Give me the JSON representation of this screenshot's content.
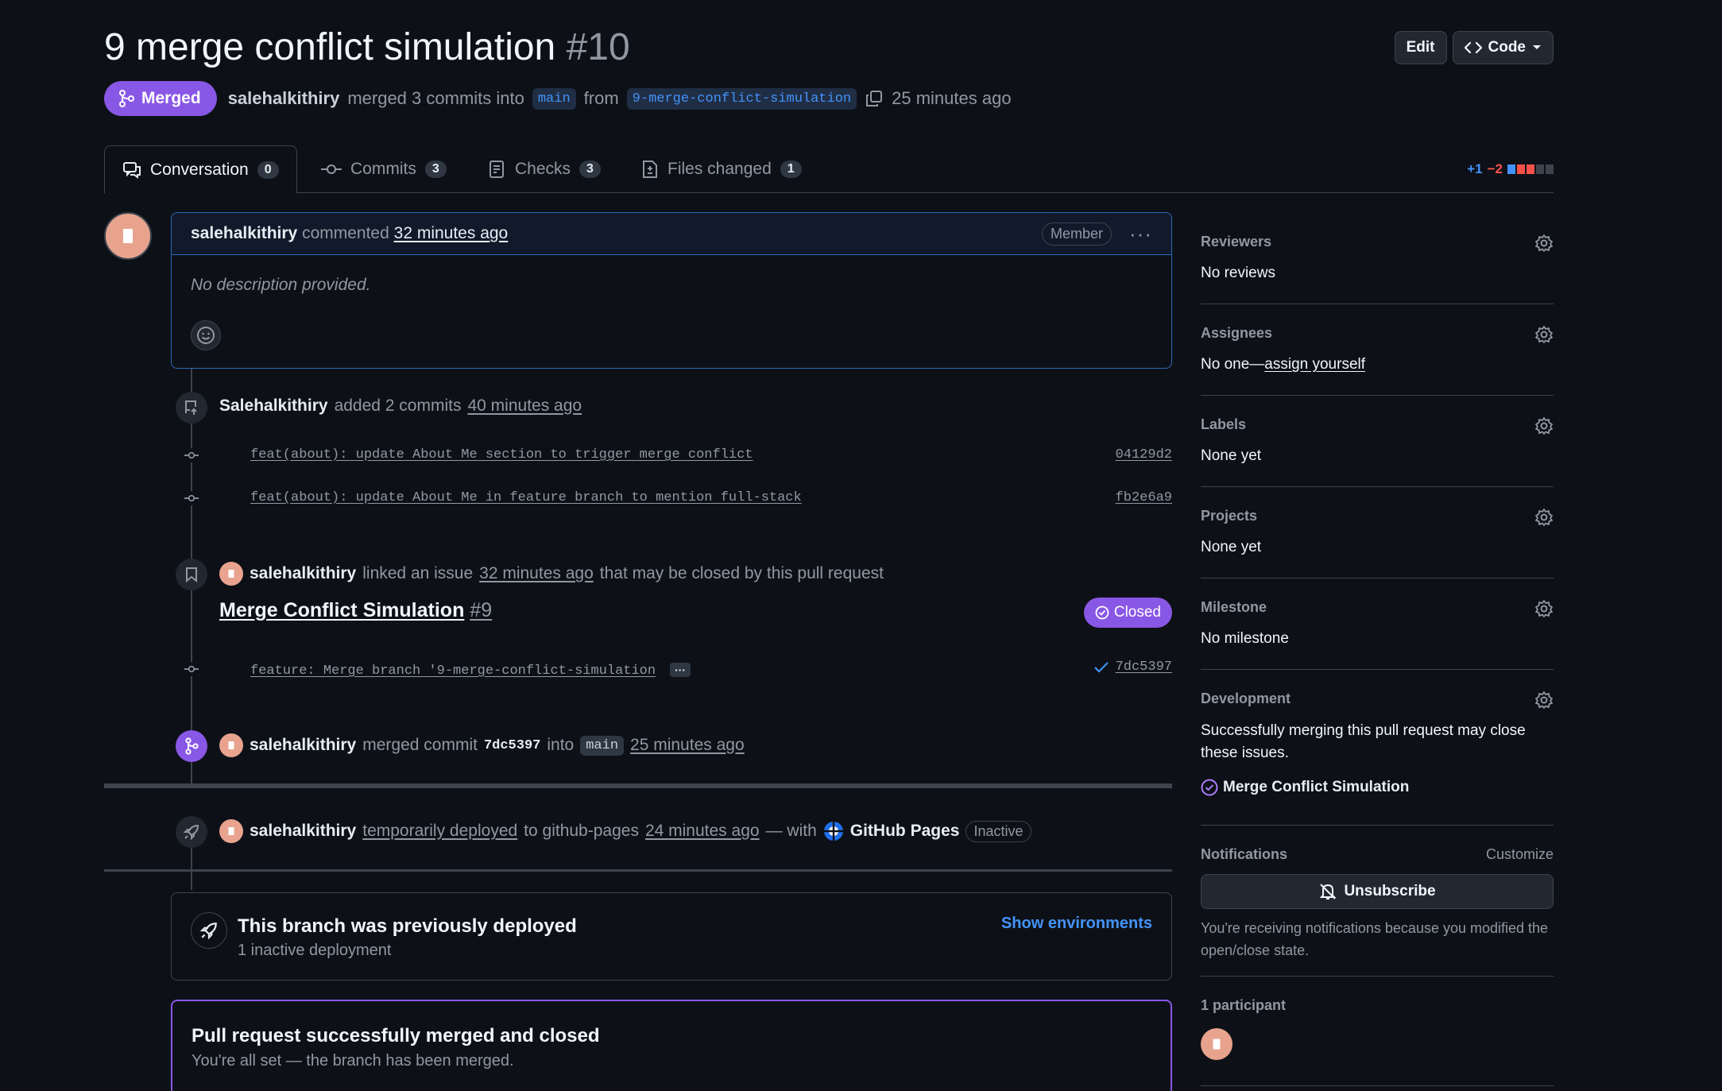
{
  "pr": {
    "title": "9 merge conflict simulation",
    "number": "#10",
    "status": "Merged",
    "author": "salehalkithiry",
    "summary_mid": "merged 3 commits into",
    "base_branch": "main",
    "from_word": "from",
    "head_branch": "9-merge-conflict-simulation",
    "time": "25 minutes ago"
  },
  "header": {
    "edit_label": "Edit",
    "code_label": "Code"
  },
  "tabs": [
    {
      "label": "Conversation",
      "count": "0"
    },
    {
      "label": "Commits",
      "count": "3"
    },
    {
      "label": "Checks",
      "count": "3"
    },
    {
      "label": "Files changed",
      "count": "1"
    }
  ],
  "diffstat": {
    "additions": "+1",
    "deletions": "−2",
    "colors": [
      "#4493f8",
      "#f85149",
      "#f85149",
      "#3d444d",
      "#3d444d"
    ]
  },
  "comment": {
    "author": "salehalkithiry",
    "action": "commented",
    "time": "32 minutes ago",
    "role": "Member",
    "menu": "···",
    "body": "No description provided."
  },
  "timeline": {
    "commits_event": {
      "author": "Salehalkithiry",
      "action": "added 2 commits",
      "time": "40 minutes ago"
    },
    "commits": [
      {
        "message": "feat(about): update About Me section to trigger merge conflict",
        "sha": "04129d2"
      },
      {
        "message": "feat(about): update About Me in feature branch to mention full-stack",
        "sha": "fb2e6a9"
      }
    ],
    "linked": {
      "author": "salehalkithiry",
      "action": "linked an issue",
      "time": "32 minutes ago",
      "tail": "that may be closed by this pull request"
    },
    "issue": {
      "title": "Merge Conflict Simulation",
      "number": "#9",
      "status": "Closed"
    },
    "merge_commit": {
      "message": "feature: Merge branch '9-merge-conflict-simulation",
      "ellipsis": "···",
      "sha": "7dc5397"
    },
    "merged": {
      "author": "salehalkithiry",
      "action": "merged commit",
      "sha": "7dc5397",
      "into": "into",
      "branch": "main",
      "time": "25 minutes ago"
    },
    "deployed": {
      "author": "salehalkithiry",
      "action": "temporarily deployed",
      "to": "to github-pages",
      "time": "24 minutes ago",
      "with": "— with",
      "app": "GitHub Pages",
      "state": "Inactive"
    }
  },
  "deploy_box": {
    "title": "This branch was previously deployed",
    "sub": "1 inactive deployment",
    "action": "Show environments"
  },
  "merged_box": {
    "title": "Pull request successfully merged and closed",
    "sub": "You're all set — the branch has been merged."
  },
  "sidebar": {
    "reviewers": {
      "heading": "Reviewers",
      "value": "No reviews"
    },
    "assignees": {
      "heading": "Assignees",
      "value_prefix": "No one—",
      "value_link": "assign yourself"
    },
    "labels": {
      "heading": "Labels",
      "value": "None yet"
    },
    "projects": {
      "heading": "Projects",
      "value": "None yet"
    },
    "milestone": {
      "heading": "Milestone",
      "value": "No milestone"
    },
    "development": {
      "heading": "Development",
      "text": "Successfully merging this pull request may close these issues.",
      "issue": "Merge Conflict Simulation"
    },
    "notifications": {
      "heading": "Notifications",
      "customize": "Customize",
      "button": "Unsubscribe",
      "note": "You're receiving notifications because you modified the open/close state."
    },
    "participants": {
      "heading": "1 participant"
    }
  }
}
